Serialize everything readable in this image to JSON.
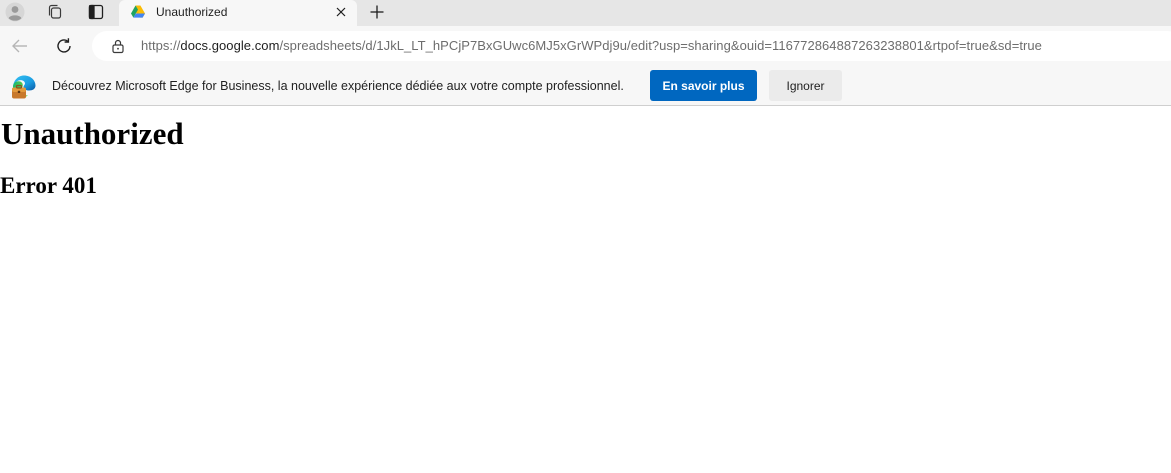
{
  "browser": {
    "tab": {
      "title": "Unauthorized",
      "favicon": "google-drive-icon"
    },
    "toolbar_icons": [
      "profile-icon",
      "collections-icon",
      "vertical-tabs-icon",
      "new-tab-icon"
    ],
    "address": {
      "scheme": "https://",
      "host": "docs.google.com",
      "path": "/spreadsheets/d/1JkL_LT_hPCjP7BxGUwc6MJ5xGrWPdj9u/edit?usp=sharing&ouid=116772864887263238801&rtpof=true&sd=true"
    }
  },
  "infobar": {
    "message": "Découvrez Microsoft Edge for Business, la nouvelle expérience dédiée aux votre compte professionnel.",
    "learn_more_label": "En savoir plus",
    "dismiss_label": "Ignorer",
    "accent_color": "#0067c0"
  },
  "page": {
    "heading": "Unauthorized",
    "subheading": "Error 401"
  }
}
